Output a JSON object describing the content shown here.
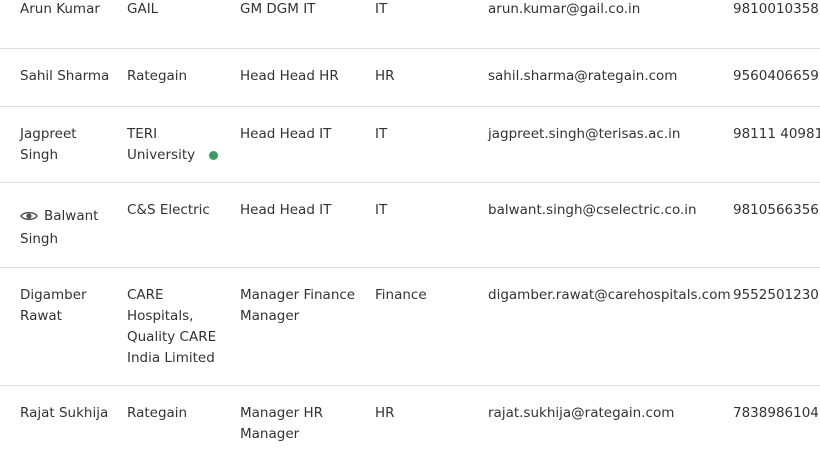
{
  "contacts": [
    {
      "name": "Arun Kumar",
      "company": "GAIL",
      "designation": "GM DGM IT",
      "department": "IT",
      "email": "arun.kumar@gail.co.in",
      "phone": "9810010358"
    },
    {
      "name": "Sahil Sharma",
      "company": "Rategain",
      "designation": "Head Head HR",
      "department": "HR",
      "email": "sahil.sharma@rategain.com",
      "phone": "9560406659"
    },
    {
      "name": "Jagpreet Singh",
      "company": "TERI University",
      "designation": "Head Head IT",
      "department": "IT",
      "email": "jagpreet.singh@terisas.ac.in",
      "phone": "98111 40981"
    },
    {
      "name": "Balwant Singh",
      "company": "C&S Electric",
      "designation": "Head Head IT",
      "department": "IT",
      "email": "balwant.singh@cselectric.co.in",
      "phone": "9810566356"
    },
    {
      "name": "Digamber Rawat",
      "company": "CARE Hospitals, Quality CARE India Limited",
      "designation": "Manager Finance Manager",
      "department": "Finance",
      "email": "digamber.rawat@carehospitals.com",
      "phone": "9552501230"
    },
    {
      "name": "Rajat Sukhija",
      "company": "Rategain",
      "designation": "Manager HR Manager",
      "department": "HR",
      "email": "rajat.sukhija@rategain.com",
      "phone": "7838986104"
    }
  ],
  "icons": {
    "view": "eye-icon",
    "status": "status-dot"
  },
  "colors": {
    "status_dot": "#3c9b5f",
    "row_divider": "#dddddd",
    "text": "#333333"
  }
}
